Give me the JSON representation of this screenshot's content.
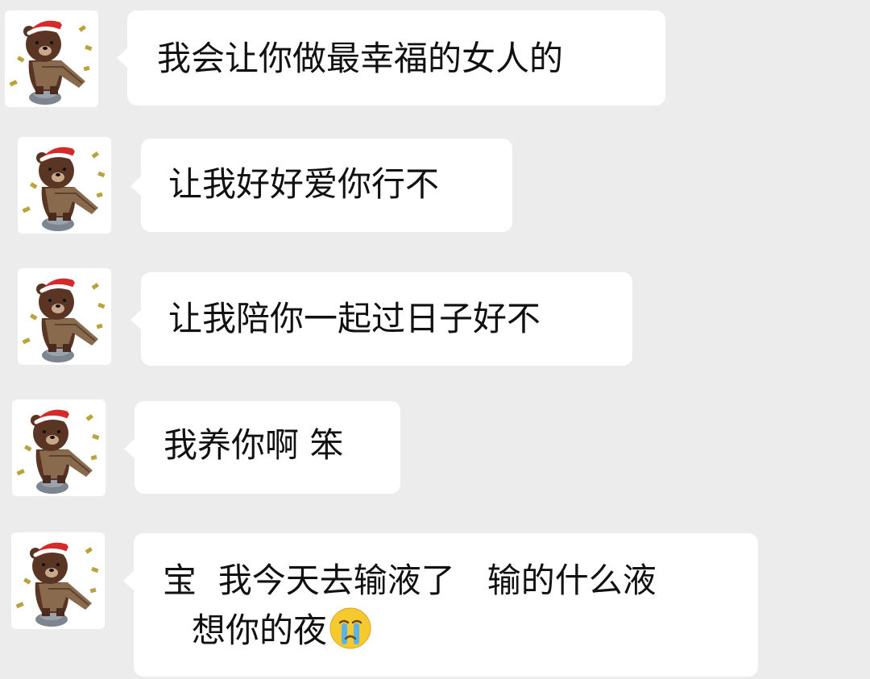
{
  "messages": [
    {
      "text": "我会让你做最幸福的女人的",
      "avatar_icon": "brown-bear-santa-hat-sticker-icon"
    },
    {
      "text": "让我好好爱你行不",
      "avatar_icon": "brown-bear-santa-hat-sticker-icon"
    },
    {
      "text": "让我陪你一起过日子好不",
      "avatar_icon": "brown-bear-santa-hat-sticker-icon"
    },
    {
      "text": "我养你啊 笨",
      "avatar_icon": "brown-bear-santa-hat-sticker-icon"
    },
    {
      "text": "宝  我今天去输液了   输的什么液",
      "text_line2": "想你的夜",
      "emoji": "crying-face-emoji",
      "avatar_icon": "brown-bear-santa-hat-sticker-icon"
    }
  ],
  "colors": {
    "background": "#ececec",
    "bubble": "#ffffff",
    "text": "#111111",
    "bear": "#5a3524",
    "hat": "#d42a2a"
  }
}
